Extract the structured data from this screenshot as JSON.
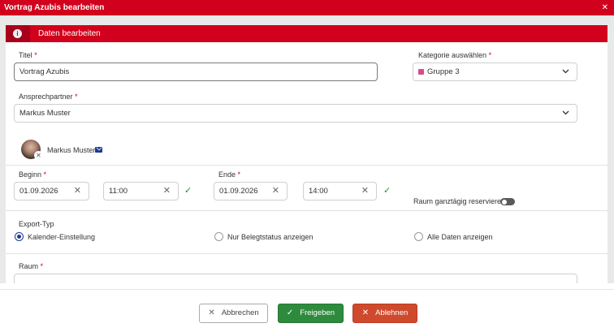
{
  "window": {
    "title": "Vortrag Azubis bearbeiten",
    "close_glyph": "✕"
  },
  "panel": {
    "title": "Daten bearbeiten",
    "info_glyph": "i"
  },
  "form": {
    "required_mark": "*",
    "title": {
      "label": "Titel",
      "value": "Vortrag Azubis"
    },
    "category": {
      "label": "Kategorie auswählen",
      "value": "Gruppe 3",
      "color": "#d94a8c"
    },
    "contact": {
      "label": "Ansprechpartner",
      "value": "Markus Muster",
      "selected_name": "Markus Muster"
    },
    "begin": {
      "label": "Beginn",
      "date": "01.09.2026",
      "time": "11:00"
    },
    "end": {
      "label": "Ende",
      "date": "01.09.2026",
      "time": "14:00"
    },
    "allday": {
      "label": "Raum ganztägig reservieren",
      "enabled": false
    },
    "export": {
      "label": "Export-Typ",
      "options": [
        "Kalender-Einstellung",
        "Nur Belegtstatus anzeigen",
        "Alle Daten anzeigen"
      ],
      "selected": "Kalender-Einstellung"
    },
    "room": {
      "label": "Raum"
    }
  },
  "buttons": {
    "cancel": {
      "label": "Abbrechen",
      "icon": "✕"
    },
    "approve": {
      "label": "Freigeben",
      "icon": "✓"
    },
    "reject": {
      "label": "Ablehnen",
      "icon": "✕"
    }
  },
  "colors": {
    "brand_red": "#d1001c",
    "approve_green": "#2e8b3e",
    "reject_orange": "#cf4a2d",
    "radio_blue": "#1f3a93"
  }
}
